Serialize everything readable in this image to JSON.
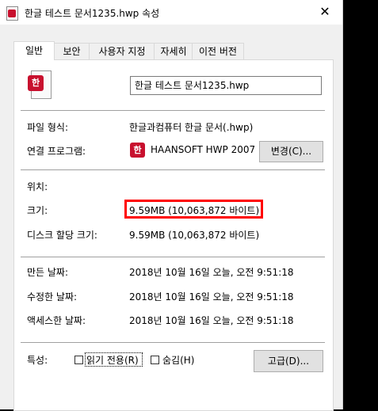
{
  "window": {
    "title": "한글 테스트 문서1235.hwp 속성",
    "close_glyph": "✕"
  },
  "tabs": [
    {
      "label": "일반",
      "active": true
    },
    {
      "label": "보안",
      "active": false
    },
    {
      "label": "사용자 지정",
      "active": false
    },
    {
      "label": "자세히",
      "active": false
    },
    {
      "label": "이전 버전",
      "active": false
    }
  ],
  "file": {
    "icon": "hwp-document-icon",
    "name": "한글 테스트 문서1235.hwp"
  },
  "properties": {
    "type_label": "파일 형식:",
    "type_value": "한글과컴퓨터 한글 문서(.hwp)",
    "opens_with_label": "연결 프로그램:",
    "opens_with_value": "HAANSOFT HWP 2007",
    "app_icon_glyph": "한",
    "change_button": "변경(C)...",
    "location_label": "위치:",
    "location_value": "",
    "size_label": "크기:",
    "size_value": "9.59MB (10,063,872 바이트)",
    "disk_size_label": "디스크 할당 크기:",
    "disk_size_value": "9.59MB (10,063,872 바이트)",
    "created_label": "만든 날짜:",
    "created_value": "2018년 10월 16일 오늘, 오전 9:51:18",
    "modified_label": "수정한 날짜:",
    "modified_value": "2018년 10월 16일 오늘, 오전 9:51:18",
    "accessed_label": "액세스한 날짜:",
    "accessed_value": "2018년 10월 16일 오늘, 오전 9:51:18",
    "attributes_label": "특성:",
    "readonly_label": "읽기 전용(R)",
    "readonly_checked": false,
    "hidden_label": "숨김(H)",
    "hidden_checked": false,
    "advanced_button": "고급(D)..."
  },
  "colors": {
    "highlight": "#ff0000",
    "hwp_brand": "#c8102e"
  }
}
